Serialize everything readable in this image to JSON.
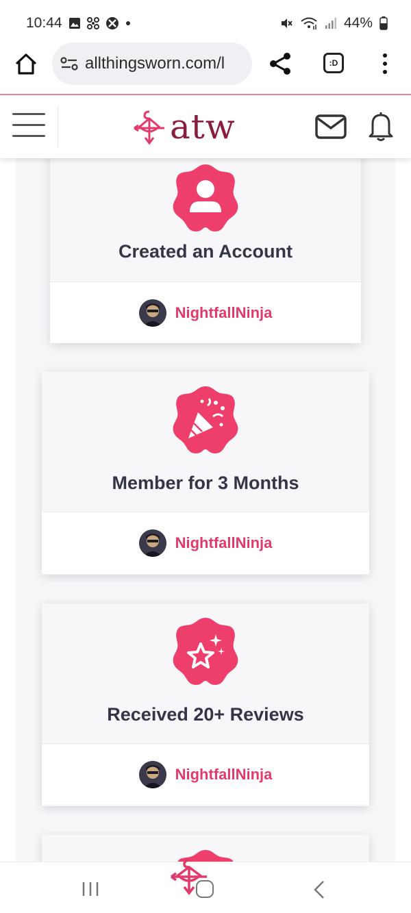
{
  "status": {
    "time": "10:44",
    "battery": "44%",
    "icons_left": [
      "gallery-icon",
      "fan-icon",
      "xbox-icon",
      "dot-icon"
    ],
    "icons_right": [
      "mute-icon",
      "wifi-icon",
      "signal-icon",
      "battery-icon"
    ]
  },
  "browser": {
    "url": "allthingsworn.com/l",
    "tab_label": ":D"
  },
  "site": {
    "logo_text": "atw"
  },
  "colors": {
    "accent": "#ee3f6c",
    "username": "#e23a6a",
    "title": "#343546",
    "logo": "#8a1d3b"
  },
  "cards": [
    {
      "title": "Created an Account",
      "icon": "person-icon",
      "username": "NightfallNinja"
    },
    {
      "title": "Member for 3 Months",
      "icon": "party-popper-icon",
      "username": "NightfallNinja"
    },
    {
      "title": "Received 20+ Reviews",
      "icon": "star-sparkle-icon",
      "username": "NightfallNinja"
    }
  ]
}
